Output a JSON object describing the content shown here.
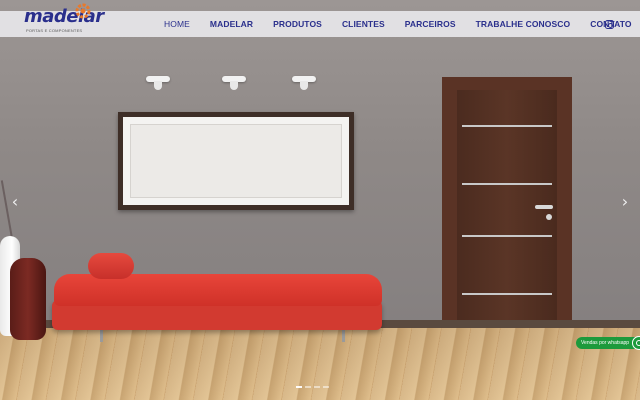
{
  "brand": {
    "name": "madelar",
    "tagline": "PORTAS E COMPONENTES",
    "color": "#2a2f8c",
    "accent": "#e8792b"
  },
  "nav": {
    "items": [
      {
        "label": "HOME",
        "active": true
      },
      {
        "label": "MADELAR",
        "active": false
      },
      {
        "label": "PRODUTOS",
        "active": false
      },
      {
        "label": "CLIENTES",
        "active": false
      },
      {
        "label": "PARCEIROS",
        "active": false
      },
      {
        "label": "TRABALHE CONOSCO",
        "active": false
      },
      {
        "label": "CONTATO",
        "active": false
      }
    ],
    "social_icon": "instagram-icon"
  },
  "slider": {
    "prev_icon": "‹",
    "next_icon": "›",
    "slide_count": 4,
    "active_slide": 1
  },
  "whatsapp": {
    "label": "Vendas por whatsapp",
    "icon": "whatsapp-icon",
    "color": "#1d9a3c"
  }
}
